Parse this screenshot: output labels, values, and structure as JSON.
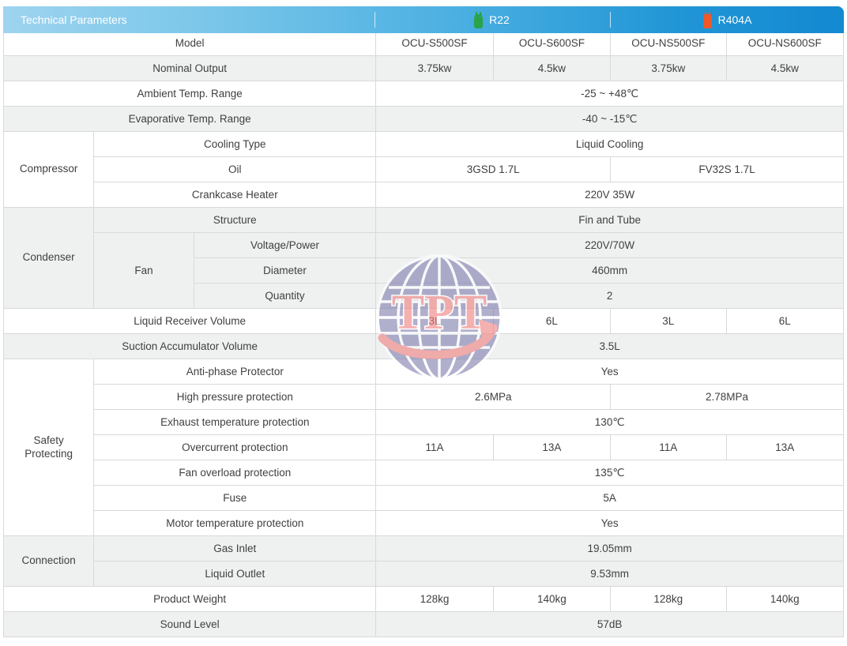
{
  "header": {
    "title": "Technical Parameters",
    "refrigerants": [
      {
        "name": "R22",
        "icon": "gas-cylinder-icon",
        "color": "#2aa34a"
      },
      {
        "name": "R404A",
        "icon": "gas-cylinder-icon",
        "color": "#f0582a"
      }
    ],
    "gradient_from": "#9ed4ef",
    "gradient_to": "#1389d2"
  },
  "colors": {
    "accent_blue": "#1b8dd3",
    "text_dark": "#404040",
    "row_tint": "#eff1f1",
    "border": "#d7d9da"
  },
  "watermark": {
    "text": "TPT",
    "globe_color": "#8080b0",
    "letter_color": "#f08080"
  },
  "columns": [
    "OCU-S500SF",
    "OCU-S600SF",
    "OCU-NS500SF",
    "OCU-NS600SF"
  ],
  "rows": {
    "model": {
      "label": "Model",
      "values": [
        "OCU-S500SF",
        "OCU-S600SF",
        "OCU-NS500SF",
        "OCU-NS600SF"
      ]
    },
    "nominal_output": {
      "label": "Nominal Output",
      "values": [
        "3.75kw",
        "4.5kw",
        "3.75kw",
        "4.5kw"
      ]
    },
    "ambient_temp": {
      "label": "Ambient Temp. Range",
      "value": "-25 ~ +48℃"
    },
    "evaporative_temp": {
      "label": "Evaporative Temp. Range",
      "value": "-40 ~ -15℃"
    },
    "compressor": {
      "group": "Compressor",
      "cooling_type": {
        "label": "Cooling Type",
        "value": "Liquid Cooling"
      },
      "oil": {
        "label": "Oil",
        "values": [
          "3GSD 1.7L",
          "FV32S 1.7L"
        ]
      },
      "crankcase_heater": {
        "label": "Crankcase Heater",
        "value": "220V 35W"
      }
    },
    "condenser": {
      "group": "Condenser",
      "structure": {
        "label": "Structure",
        "value": "Fin and Tube"
      },
      "fan": {
        "label": "Fan",
        "voltage_power": {
          "label": "Voltage/Power",
          "value": "220V/70W"
        },
        "diameter": {
          "label": "Diameter",
          "value": "460mm"
        },
        "quantity": {
          "label": "Quantity",
          "value": "2"
        }
      }
    },
    "liquid_receiver": {
      "label": "Liquid Receiver Volume",
      "values": [
        "3L",
        "6L",
        "3L",
        "6L"
      ]
    },
    "suction_accumulator": {
      "label": "Suction Accumulator Volume",
      "value": "3.5L"
    },
    "safety": {
      "group": "Safety\nProtecting",
      "group_line1": "Safety",
      "group_line2": "Protecting",
      "anti_phase": {
        "label": "Anti-phase Protector",
        "value": "Yes"
      },
      "high_pressure": {
        "label": "High pressure protection",
        "values": [
          "2.6MPa",
          "2.78MPa"
        ]
      },
      "exhaust_temp": {
        "label": "Exhaust temperature protection",
        "value": "130℃"
      },
      "overcurrent": {
        "label": "Overcurrent protection",
        "values": [
          "11A",
          "13A",
          "11A",
          "13A"
        ]
      },
      "fan_overload": {
        "label": "Fan overload protection",
        "value": "135℃"
      },
      "fuse": {
        "label": "Fuse",
        "value": "5A"
      },
      "motor_temp": {
        "label": "Motor temperature protection",
        "value": "Yes"
      }
    },
    "connection": {
      "group": "Connection",
      "gas_inlet": {
        "label": "Gas Inlet",
        "value": "19.05mm"
      },
      "liquid_outlet": {
        "label": "Liquid Outlet",
        "value": "9.53mm"
      }
    },
    "product_weight": {
      "label": "Product Weight",
      "values": [
        "128kg",
        "140kg",
        "128kg",
        "140kg"
      ]
    },
    "sound_level": {
      "label": "Sound Level",
      "value": "57dB"
    }
  }
}
